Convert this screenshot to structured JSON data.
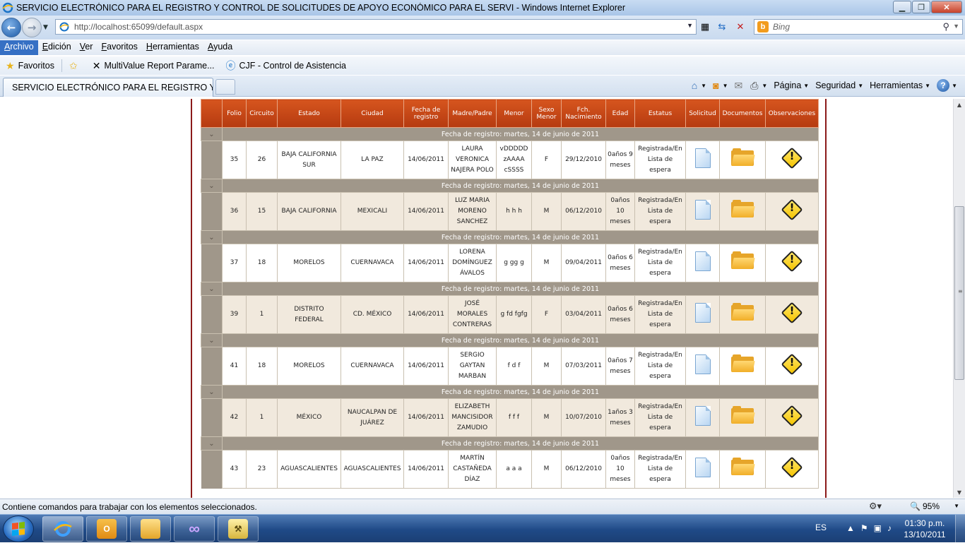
{
  "window": {
    "title": "SERVICIO ELECTRÓNICO PARA EL REGISTRO Y CONTROL DE SOLICITUDES DE APOYO ECONÓMICO PARA EL SERVI - Windows Internet Explorer"
  },
  "address_bar": {
    "url": "http://localhost:65099/default.aspx"
  },
  "search_bar": {
    "placeholder": "Bing"
  },
  "menubar": {
    "items": [
      "Archivo",
      "Edición",
      "Ver",
      "Favoritos",
      "Herramientas",
      "Ayuda"
    ]
  },
  "favorites_bar": {
    "favorites_label": "Favoritos",
    "links": [
      "MultiValue Report Parame...",
      "CJF - Control de Asistencia"
    ]
  },
  "tabs": {
    "active_tab": "SERVICIO ELECTRÓNICO PARA EL REGISTRO Y C..."
  },
  "command_bar": {
    "page": "Página",
    "security": "Seguridad",
    "tools": "Herramientas"
  },
  "grid": {
    "columns": [
      "Folio",
      "Circuito",
      "Estado",
      "Ciudad",
      "Fecha de registro",
      "Madre/Padre",
      "Menor",
      "Sexo Menor",
      "Fch. Nacimiento",
      "Edad",
      "Estatus",
      "Solicitud",
      "Documentos",
      "Observaciones"
    ],
    "rows": [
      {
        "group": "Fecha de registro: martes, 14 de junio de 2011",
        "folio": "35",
        "circuito": "26",
        "estado": "BAJA CALIFORNIA SUR",
        "ciudad": "LA PAZ",
        "fecha": "14/06/2011",
        "madre_padre": "LAURA VERONICA NAJERA POLO",
        "menor": "vDDDDD zAAAA cSSSS",
        "sexo": "F",
        "nacimiento": "29/12/2010",
        "edad": "0años 9 meses",
        "estatus": "Registrada/En Lista de espera"
      },
      {
        "group": "Fecha de registro: martes, 14 de junio de 2011",
        "folio": "36",
        "circuito": "15",
        "estado": "BAJA CALIFORNIA",
        "ciudad": "MEXICALI",
        "fecha": "14/06/2011",
        "madre_padre": "LUZ MARIA MORENO SANCHEZ",
        "menor": "h h h",
        "sexo": "M",
        "nacimiento": "06/12/2010",
        "edad": "0años 10 meses",
        "estatus": "Registrada/En Lista de espera"
      },
      {
        "group": "Fecha de registro: martes, 14 de junio de 2011",
        "folio": "37",
        "circuito": "18",
        "estado": "MORELOS",
        "ciudad": "CUERNAVACA",
        "fecha": "14/06/2011",
        "madre_padre": "LORENA DOMÍNGUEZ ÁVALOS",
        "menor": "g gg g",
        "sexo": "M",
        "nacimiento": "09/04/2011",
        "edad": "0años 6 meses",
        "estatus": "Registrada/En Lista de espera"
      },
      {
        "group": "Fecha de registro: martes, 14 de junio de 2011",
        "folio": "39",
        "circuito": "1",
        "estado": "DISTRITO FEDERAL",
        "ciudad": "CD. MÉXICO",
        "fecha": "14/06/2011",
        "madre_padre": "JOSÉ MORALES CONTRERAS",
        "menor": "g fd fgfg",
        "sexo": "F",
        "nacimiento": "03/04/2011",
        "edad": "0años 6 meses",
        "estatus": "Registrada/En Lista de espera"
      },
      {
        "group": "Fecha de registro: martes, 14 de junio de 2011",
        "folio": "41",
        "circuito": "18",
        "estado": "MORELOS",
        "ciudad": "CUERNAVACA",
        "fecha": "14/06/2011",
        "madre_padre": "SERGIO GAYTAN MARBAN",
        "menor": "f d f",
        "sexo": "M",
        "nacimiento": "07/03/2011",
        "edad": "0años 7 meses",
        "estatus": "Registrada/En Lista de espera"
      },
      {
        "group": "Fecha de registro: martes, 14 de junio de 2011",
        "folio": "42",
        "circuito": "1",
        "estado": "MÉXICO",
        "ciudad": "NAUCALPAN DE JUÁREZ",
        "fecha": "14/06/2011",
        "madre_padre": "ELIZABETH MANCISIDOR ZAMUDIO",
        "menor": "f f f",
        "sexo": "M",
        "nacimiento": "10/07/2010",
        "edad": "1años 3 meses",
        "estatus": "Registrada/En Lista de espera"
      },
      {
        "group": "Fecha de registro: martes, 14 de junio de 2011",
        "folio": "43",
        "circuito": "23",
        "estado": "AGUASCALIENTES",
        "ciudad": "AGUASCALIENTES",
        "fecha": "14/06/2011",
        "madre_padre": "MARTÍN CASTAÑEDA DÍAZ",
        "menor": "a a a",
        "sexo": "M",
        "nacimiento": "06/12/2010",
        "edad": "0años 10 meses",
        "estatus": "Registrada/En Lista de espera"
      }
    ]
  },
  "status_bar": {
    "text": "Contiene comandos para trabajar con los elementos seleccionados.",
    "zoom": "95%"
  },
  "taskbar": {
    "language": "ES",
    "time": "01:30 p.m.",
    "date": "13/10/2011"
  }
}
